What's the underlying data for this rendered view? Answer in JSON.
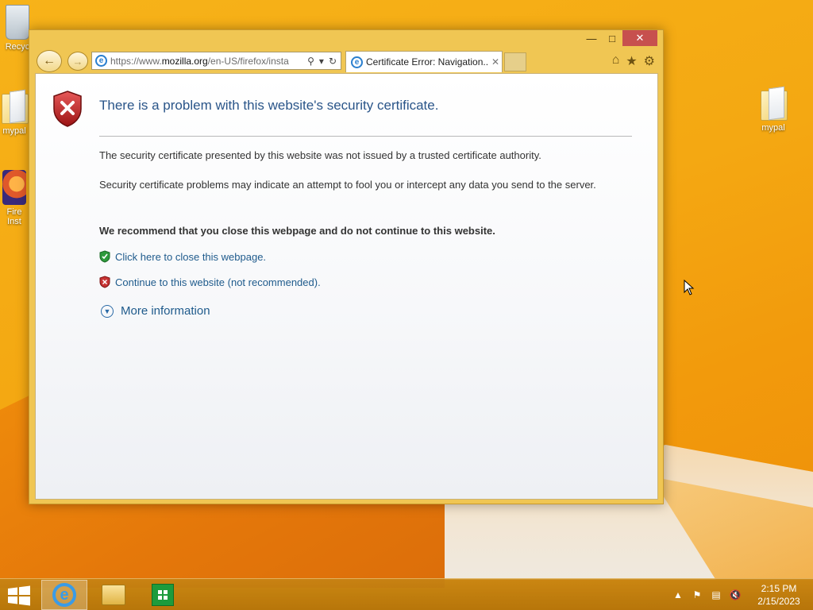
{
  "desktop": {
    "icons": [
      {
        "label": "Recyc"
      },
      {
        "label": "mypal"
      },
      {
        "label": "Fire\nInst"
      },
      {
        "label": "mypal"
      }
    ]
  },
  "browser": {
    "address_url_prefix": "https://www.",
    "address_url_domain": "mozilla.org",
    "address_url_suffix": "/en-US/firefox/insta",
    "tab_title": "Certificate Error: Navigation...",
    "tab_close": "✕"
  },
  "page": {
    "heading": "There is a problem with this website's security certificate.",
    "paragraph1": "The security certificate presented by this website was not issued by a trusted certificate authority.",
    "paragraph2": "Security certificate problems may indicate an attempt to fool you or intercept any data you send to the server.",
    "recommendation": "We recommend that you close this webpage and do not continue to this website.",
    "close_link": "Click here to close this webpage.",
    "continue_link": "Continue to this website (not recommended).",
    "more_info": "More information"
  },
  "taskbar": {
    "time": "2:15 PM",
    "date": "2/15/2023"
  }
}
